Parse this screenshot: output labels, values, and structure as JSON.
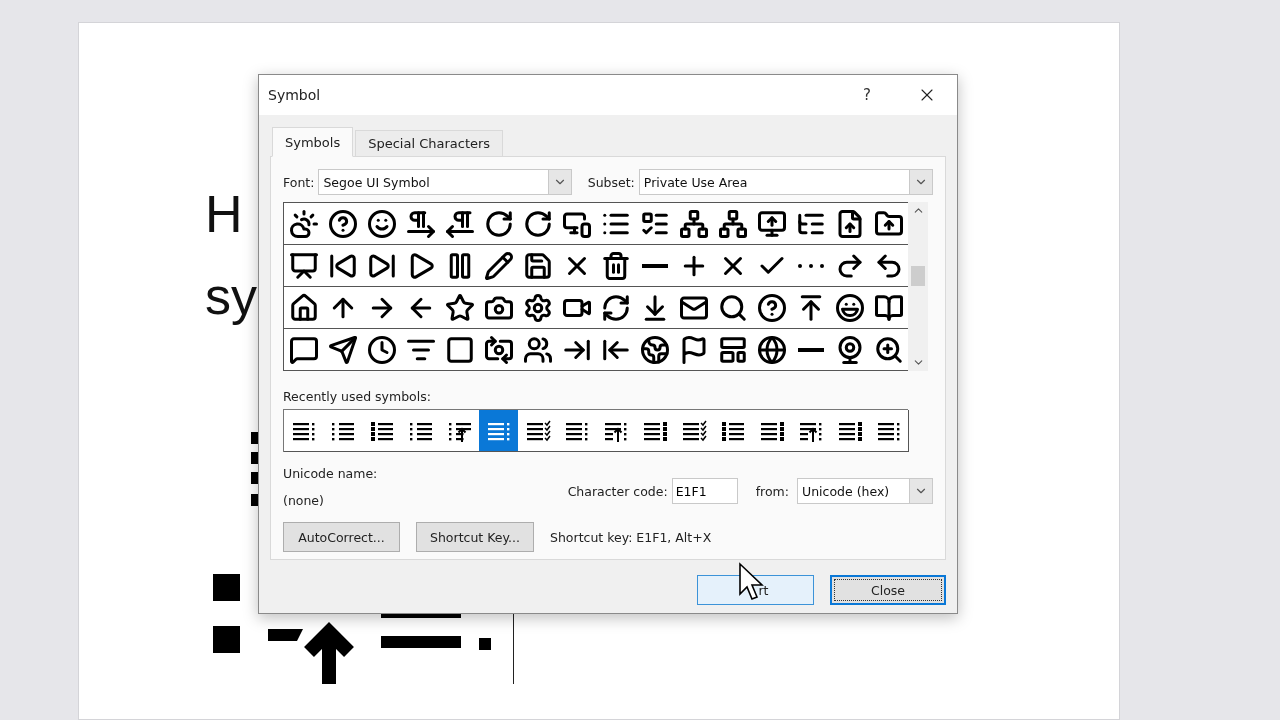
{
  "document": {
    "lines": [
      "H",
      "sy"
    ]
  },
  "dialog": {
    "title": "Symbol",
    "help": "?",
    "tabs": [
      {
        "label": "Symbols",
        "selected": true
      },
      {
        "label": "Special Characters",
        "selected": false
      }
    ],
    "font": {
      "label": "Font:",
      "value": "Segoe UI Symbol"
    },
    "subset": {
      "label": "Subset:",
      "value": "Private Use Area"
    },
    "recent_label": "Recently used symbols:",
    "recent_symbols": [
      {
        "selected": false
      },
      {
        "selected": false
      },
      {
        "selected": false
      },
      {
        "selected": false
      },
      {
        "selected": false
      },
      {
        "selected": true
      },
      {
        "selected": false
      },
      {
        "selected": false
      },
      {
        "selected": false
      },
      {
        "selected": false
      },
      {
        "selected": false
      },
      {
        "selected": false
      },
      {
        "selected": false
      },
      {
        "selected": false
      },
      {
        "selected": false
      },
      {
        "selected": false
      }
    ],
    "unicode_name_label": "Unicode name:",
    "unicode_name": "(none)",
    "character_code": {
      "label": "Character code:",
      "value": "E1F1"
    },
    "from": {
      "label": "from:",
      "value": "Unicode (hex)"
    },
    "buttons": [
      {
        "label": "AutoCorrect..."
      },
      {
        "label": "Shortcut Key..."
      }
    ],
    "shortcut_text": "Shortcut key: E1F1, Alt+X",
    "footer_buttons": [
      {
        "label": "rt",
        "default": false
      },
      {
        "label": "Close",
        "default": true
      }
    ]
  }
}
